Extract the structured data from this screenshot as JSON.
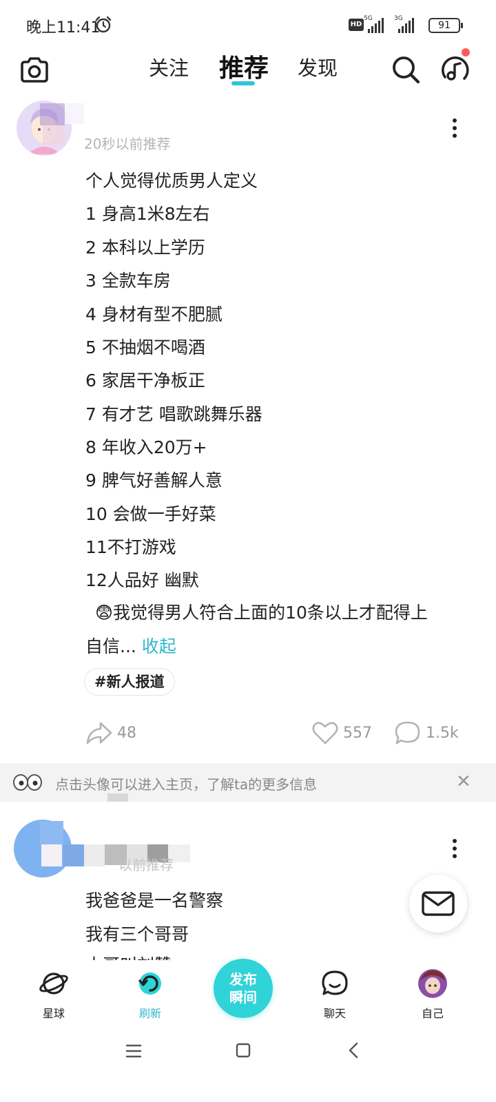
{
  "status_bar": {
    "time": "晚上11:41",
    "hd": "HD",
    "network1": "5G",
    "network2": "3G",
    "battery": "91"
  },
  "top_nav": {
    "tabs": [
      "关注",
      "推荐",
      "发现"
    ],
    "active_tab": "推荐"
  },
  "post1": {
    "meta": "20秒以前推荐",
    "lines": [
      "个人觉得优质男人定义",
      "1  身高1米8左右",
      "2  本科以上学历",
      "3  全款车房",
      "4  身材有型不肥腻",
      "5  不抽烟不喝酒",
      "6  家居干净板正",
      "7 有才艺 唱歌跳舞乐器",
      "8 年收入20万+",
      "9  脾气好善解人意",
      "10 会做一手好菜",
      "11不打游戏",
      "12人品好 幽默"
    ],
    "emoji": "😨",
    "closing_line": "我觉得男人符合上面的10条以上才配得上",
    "last_line": "自信...",
    "collapse": "收起",
    "hashtag": "#新人报道",
    "shares": "48",
    "likes": "557",
    "comments": "1.5k"
  },
  "tip": {
    "text": "点击头像可以进入主页，了解ta的更多信息",
    "close": "✕"
  },
  "post2": {
    "meta": "以前推荐",
    "lines": [
      "我爸爸是一名警察",
      "我有三个哥哥",
      "大哥叫刘赞"
    ]
  },
  "bottom_tabs": [
    {
      "label": "星球",
      "icon": "planet-icon"
    },
    {
      "label": "刷新",
      "icon": "refresh-icon",
      "active": true
    },
    {
      "label": "聊天",
      "icon": "chat-icon"
    },
    {
      "label": "自己",
      "icon": "profile-avatar"
    }
  ],
  "publish": {
    "line1": "发布",
    "line2": "瞬间"
  },
  "colors": {
    "accent": "#2fb8c8",
    "publish_bg": "#2fd3d8",
    "notify_dot": "#ff5a5a"
  }
}
